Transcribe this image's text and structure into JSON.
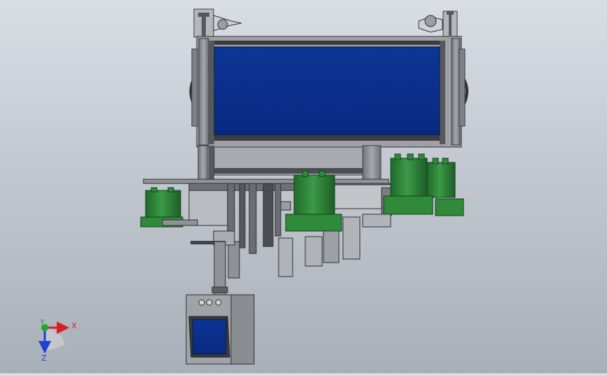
{
  "viewport": {
    "background_top": "#d9dde4",
    "background_bottom": "#a9afb8"
  },
  "colors": {
    "panel_blue": "#0a2e8c",
    "frame_gray": "#8c8f93",
    "frame_dark": "#3c3f43",
    "cylinder_green": "#2f8a3a",
    "cylinder_dark": "#1d5e27"
  },
  "model": {
    "parts": [
      "top-frame-with-blue-panel",
      "left-caster-bracket",
      "right-caster-bracket",
      "lower-manifold-rail",
      "left-green-cylinder",
      "center-green-cylinder",
      "right-green-cylinder-pair",
      "gripper-assemblies",
      "center-support-column",
      "bottom-control-box-with-screen"
    ]
  },
  "triad": {
    "x_label": "X",
    "y_label": "Y",
    "z_label": "Z",
    "x_color": "#d62020",
    "y_color": "#1fa82a",
    "z_color": "#1f3fd0"
  }
}
